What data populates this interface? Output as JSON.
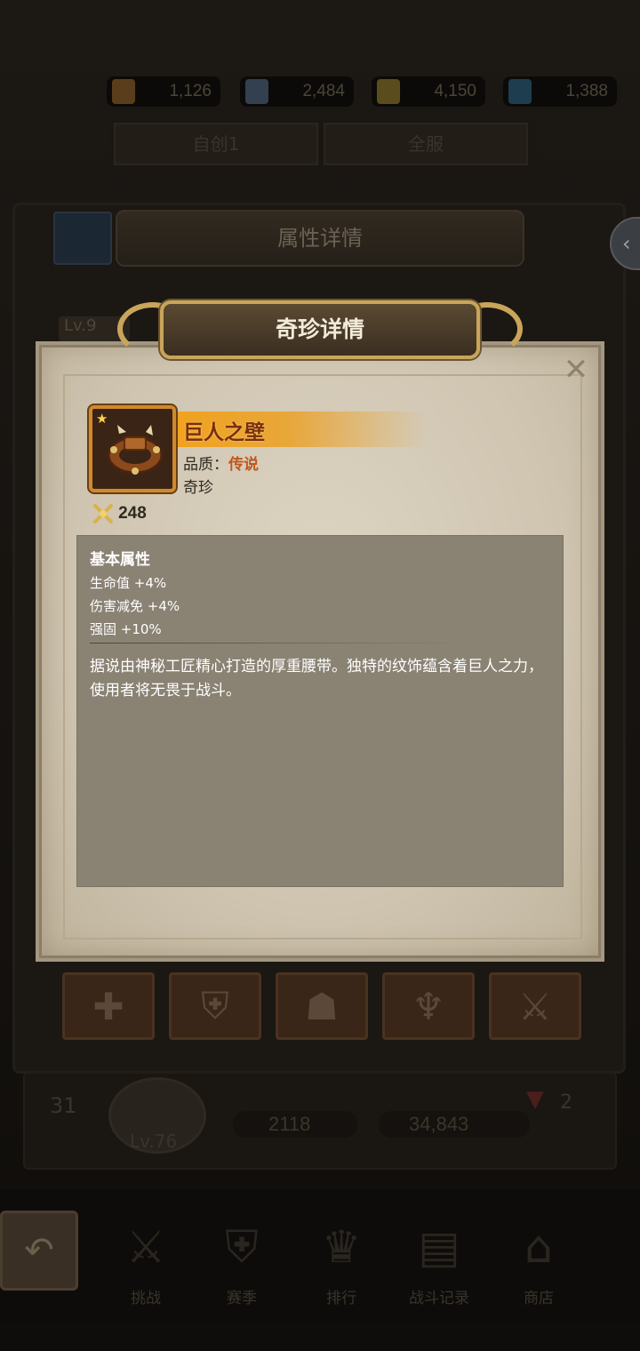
{
  "currency": [
    {
      "icon": "wood-resource-icon",
      "value": "1,126",
      "color": "#6a4a22"
    },
    {
      "icon": "scroll-resource-icon",
      "value": "2,484",
      "color": "#3c4a5a"
    },
    {
      "icon": "gold-resource-icon",
      "value": "4,150",
      "color": "#6a5a22"
    },
    {
      "icon": "crystal-resource-icon",
      "value": "1,388",
      "color": "#23475a"
    }
  ],
  "background_tabs": [
    "自创1",
    "全服"
  ],
  "background_panel": {
    "title": "属性详情",
    "level_badge": "Lv.9"
  },
  "background_player": {
    "rank": "31",
    "level": "Lv.76",
    "power": "2118",
    "score": "34,843",
    "rank_change": "2"
  },
  "bottom_nav": [
    {
      "icon": "swords-icon",
      "label": "挑战"
    },
    {
      "icon": "shield-icon",
      "label": "赛季"
    },
    {
      "icon": "trophy-icon",
      "label": "排行"
    },
    {
      "icon": "scroll-icon",
      "label": "战斗记录"
    },
    {
      "icon": "shop-icon",
      "label": "商店"
    }
  ],
  "dialog": {
    "title": "奇珍详情",
    "item": {
      "name": "巨人之壁",
      "quality_label": "品质：",
      "quality_value": "传说",
      "category": "奇珍",
      "score": "248",
      "star": "★"
    },
    "attributes": {
      "title": "基本属性",
      "lines": [
        "生命值 +4%",
        "伤害减免 +4%",
        "强固 +10%"
      ],
      "description": "据说由神秘工匠精心打造的厚重腰带。独特的纹饰蕴含着巨人之力，使用者将无畏于战斗。"
    }
  },
  "colors": {
    "legendary": "#c0561c",
    "name_bar": "#f0a21f",
    "frame_gold": "#c9a55a"
  }
}
